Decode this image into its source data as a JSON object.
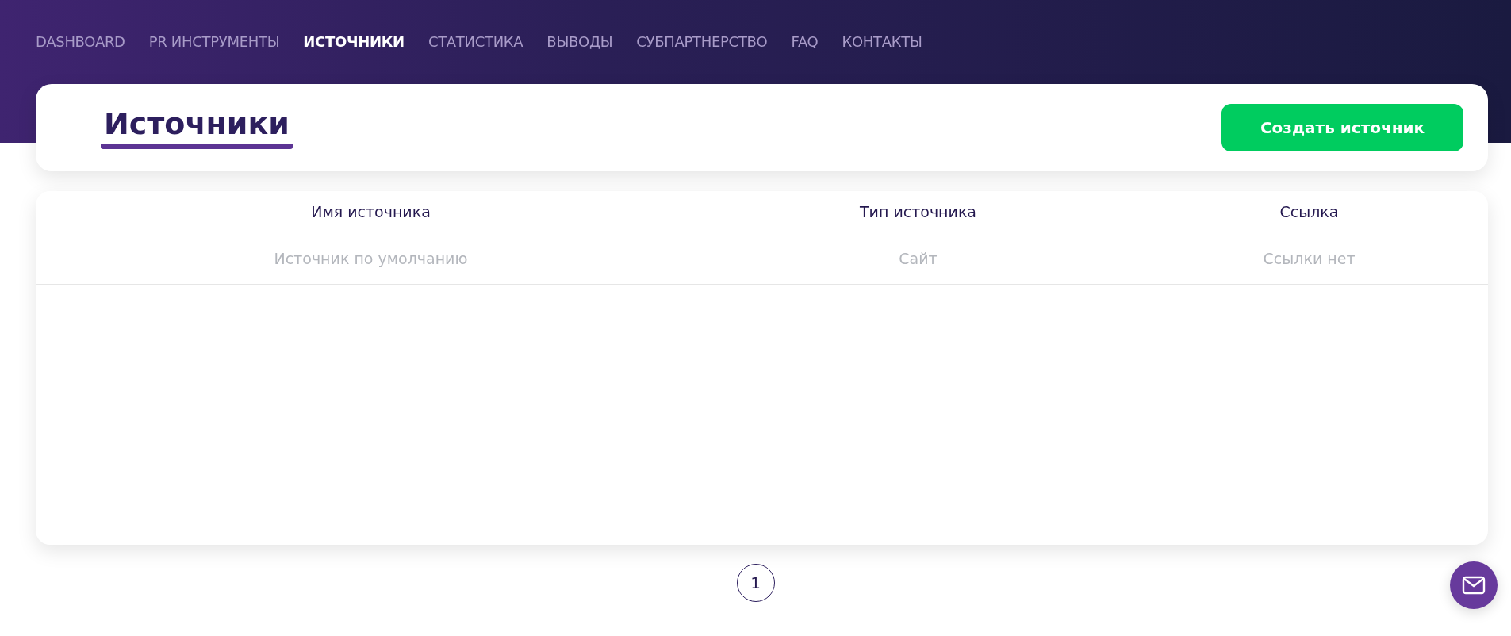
{
  "nav": [
    {
      "label": "DASHBOARD",
      "selected": false
    },
    {
      "label": "PR ИНСТРУМЕНТЫ",
      "selected": false
    },
    {
      "label": "ИСТОЧНИКИ",
      "selected": true
    },
    {
      "label": "СТАТИСТИКА",
      "selected": false
    },
    {
      "label": "ВЫВОДЫ",
      "selected": false
    },
    {
      "label": "СУБПАРТНЕРСТВО",
      "selected": false
    },
    {
      "label": "FAQ",
      "selected": false
    },
    {
      "label": "КОНТАКТЫ",
      "selected": false
    }
  ],
  "page_title": "Источники",
  "create_button": "Создать источник",
  "table": {
    "columns": [
      "Имя источника",
      "Тип источника",
      "Ссылка"
    ],
    "rows": [
      [
        "Источник по умолчанию",
        "Сайт",
        "Ссылки нет"
      ]
    ]
  },
  "pagination": [
    {
      "label": "1",
      "selected": true
    }
  ]
}
